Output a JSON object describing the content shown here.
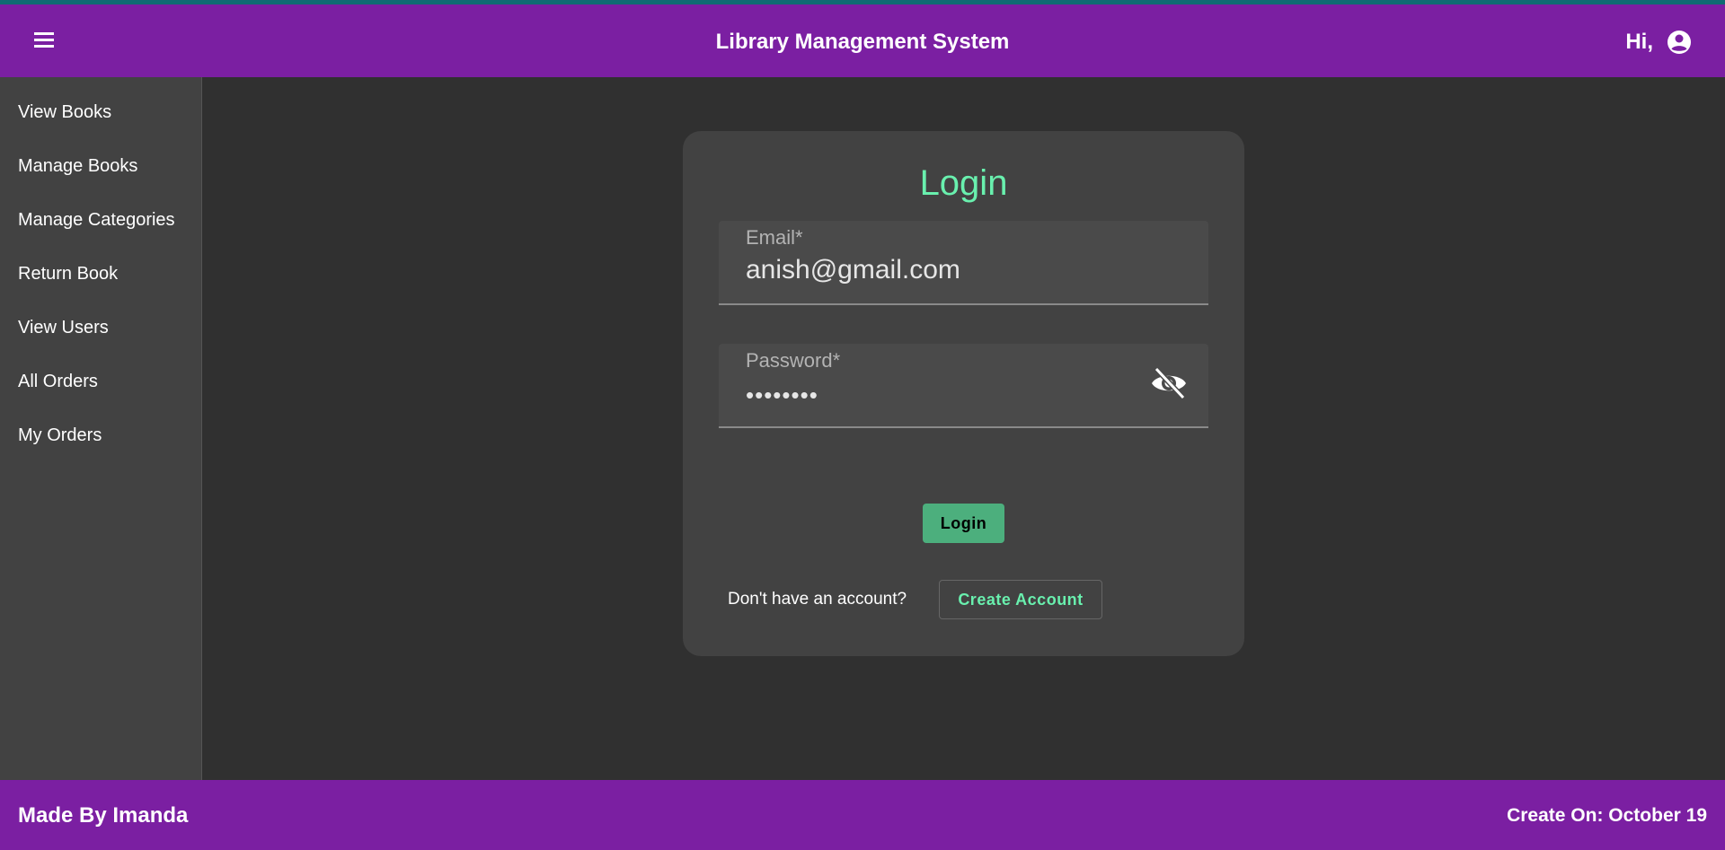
{
  "header": {
    "title": "Library Management System",
    "greeting": "Hi,",
    "menu_icon": "hamburger-menu-icon",
    "account_icon": "account-circle-icon"
  },
  "sidebar": {
    "items": [
      {
        "label": "View Books"
      },
      {
        "label": "Manage Books"
      },
      {
        "label": "Manage Categories"
      },
      {
        "label": "Return Book"
      },
      {
        "label": "View Users"
      },
      {
        "label": "All Orders"
      },
      {
        "label": "My Orders"
      }
    ]
  },
  "login": {
    "title": "Login",
    "email_label": "Email*",
    "email_value": "anish@gmail.com",
    "password_label": "Password*",
    "password_value": "••••••••",
    "password_toggle_icon": "eye-off-icon",
    "submit_label": "Login",
    "no_account_text": "Don't have an account?",
    "create_account_label": "Create Account"
  },
  "footer": {
    "left": "Made By Imanda",
    "right": "Create On: October 19"
  },
  "colors": {
    "header_bg": "#7b1fa2",
    "accent_green": "#69f0ae",
    "button_green": "#4caf7d",
    "page_bg": "#303030",
    "card_bg": "#424242"
  }
}
